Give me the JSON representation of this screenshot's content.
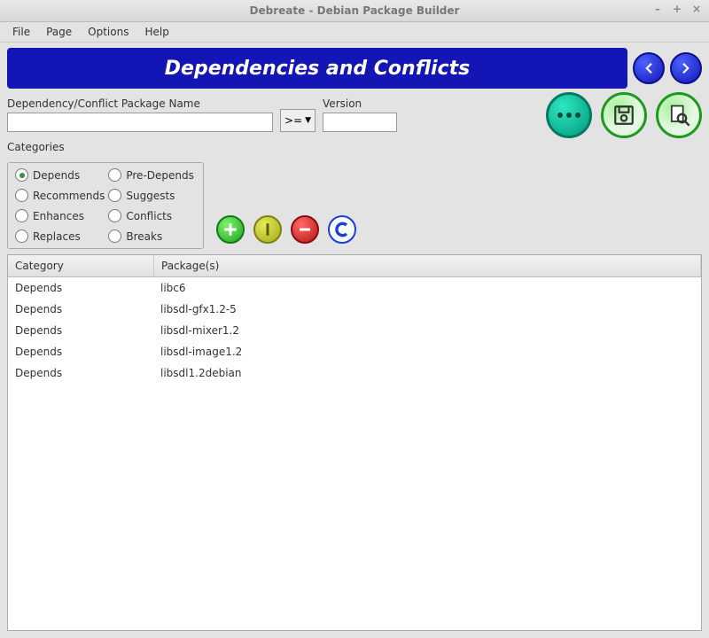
{
  "window": {
    "title": "Debreate - Debian Package Builder"
  },
  "menubar": [
    "File",
    "Page",
    "Options",
    "Help"
  ],
  "page_title": "Dependencies and Conflicts",
  "labels": {
    "package_name": "Dependency/Conflict Package Name",
    "version": "Version",
    "categories": "Categories"
  },
  "inputs": {
    "package_name_value": "",
    "version_value": "",
    "operator_selected": ">="
  },
  "categories": {
    "selected": "Depends",
    "options": [
      "Depends",
      "Pre-Depends",
      "Recommends",
      "Suggests",
      "Enhances",
      "Conflicts",
      "Replaces",
      "Breaks"
    ]
  },
  "table": {
    "headers": {
      "category": "Category",
      "packages": "Package(s)"
    },
    "rows": [
      {
        "category": "Depends",
        "package": "libc6"
      },
      {
        "category": "Depends",
        "package": "libsdl-gfx1.2-5"
      },
      {
        "category": "Depends",
        "package": "libsdl-mixer1.2"
      },
      {
        "category": "Depends",
        "package": "libsdl-image1.2"
      },
      {
        "category": "Depends",
        "package": "libsdl1.2debian"
      }
    ]
  }
}
